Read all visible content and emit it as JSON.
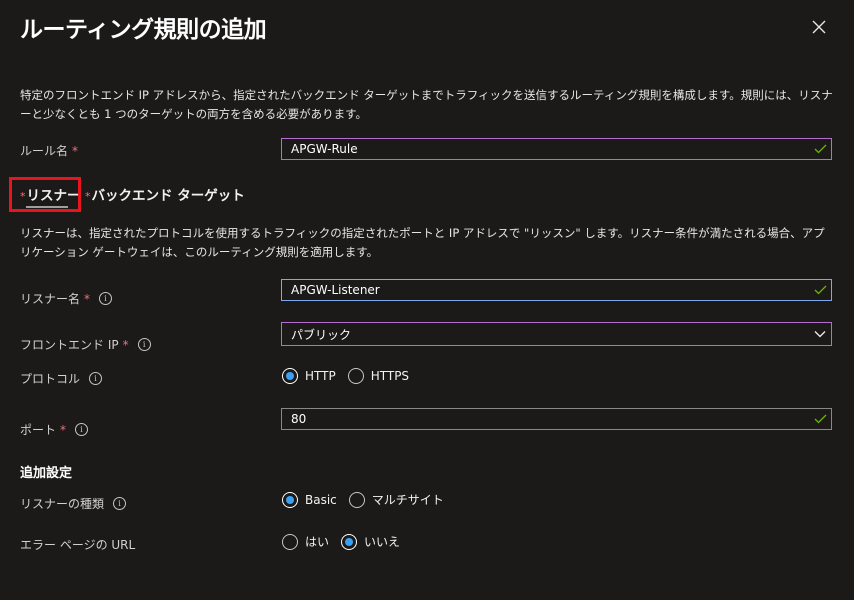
{
  "panel": {
    "title": "ルーティング規則の追加",
    "description": "特定のフロントエンド IP アドレスから、指定されたバックエンド ターゲットまでトラフィックを送信するルーティング規則を構成します。規則には、リスナーと少なくとも 1 つのターゲットの両方を含める必要があります。"
  },
  "rule_name": {
    "label": "ルール名",
    "value": "APGW-Rule",
    "valid": true
  },
  "tabs": [
    {
      "label": "リスナー",
      "required": true,
      "selected": true
    },
    {
      "label": "バックエンド ターゲット",
      "required": true,
      "selected": false
    }
  ],
  "listener": {
    "description": "リスナーは、指定されたプロトコルを使用するトラフィックの指定されたポートと IP アドレスで \"リッスン\" します。リスナー条件が満たされる場合、アプリケーション ゲートウェイは、このルーティング規則を適用します。",
    "name": {
      "label": "リスナー名",
      "value": "APGW-Listener"
    },
    "frontend_ip": {
      "label": "フロントエンド IP",
      "value": "パブリック"
    },
    "protocol": {
      "label": "プロトコル",
      "options": [
        "HTTP",
        "HTTPS"
      ],
      "selected": "HTTP"
    },
    "port": {
      "label": "ポート",
      "value": "80"
    }
  },
  "additional": {
    "heading": "追加設定",
    "listener_type": {
      "label": "リスナーの種類",
      "options": [
        "Basic",
        "マルチサイト"
      ],
      "selected": "Basic"
    },
    "error_page_url": {
      "label": "エラー ページの URL",
      "options": [
        "はい",
        "いいえ"
      ],
      "selected": "いいえ"
    }
  },
  "colors": {
    "background": "#1b1a19",
    "required_star": "#f1707b",
    "radio_selected": "#3aa0f3",
    "valid_check": "#6bb700",
    "highlight": "#e8141e"
  }
}
